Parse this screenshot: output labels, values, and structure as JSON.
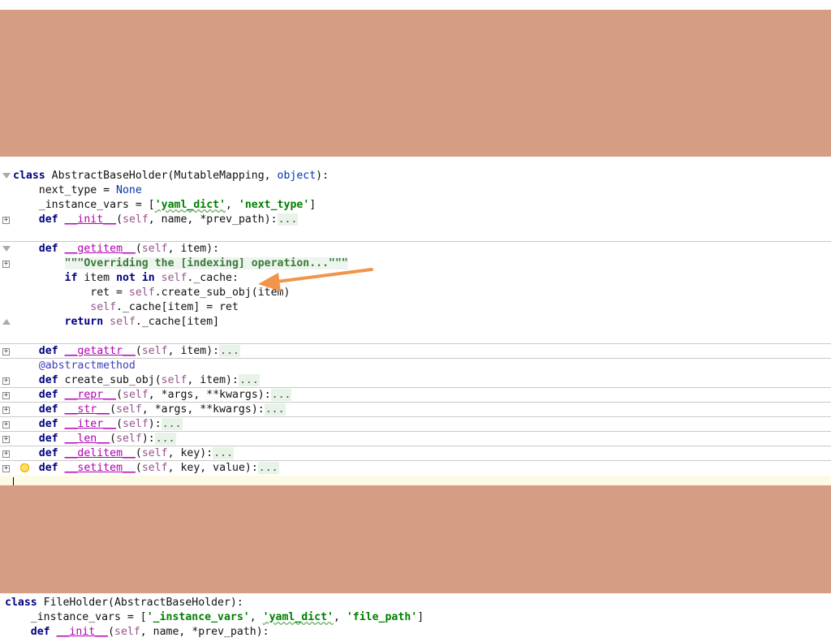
{
  "colors": {
    "band": "#d49d84",
    "arrow": "#f0954a",
    "keyword": "#000080",
    "string": "#008000",
    "self": "#94558d",
    "caret_line": "#fdfbe6"
  },
  "editor": {
    "class_line": {
      "kw": "class",
      "rest": " AbstractBaseHolder(MutableMapping, ",
      "builtin": "object",
      "end": "):"
    },
    "next_type": {
      "name": "next_type = ",
      "value": "None"
    },
    "instance_vars": {
      "prefix": "_instance_vars = [",
      "s1": "'yaml_dict'",
      "mid": ", ",
      "s2": "'next_type'",
      "end": "]"
    },
    "init": {
      "kw": "def",
      "name": "__init__",
      "open": "(",
      "self": "self",
      "args": ", name, *prev_path):",
      "fold": "..."
    },
    "getitem": {
      "kw": "def",
      "name": "__getitem__",
      "open": "(",
      "self": "self",
      "args": ", item):"
    },
    "docstring": "\"\"\"Overriding the [indexing] operation...\"\"\"",
    "if_line": {
      "kw1": "if",
      "mid1": " item ",
      "kw2": "not in",
      "mid2": " ",
      "self": "self",
      "rest": "._cache:"
    },
    "ret_line": {
      "prefix": "ret = ",
      "self": "self",
      "rest": ".create_sub_obj(item)"
    },
    "cache_line": {
      "self": "self",
      "rest": "._cache[item] = ret"
    },
    "return_line": {
      "kw": "return",
      "mid": " ",
      "self": "self",
      "rest": "._cache[item]"
    },
    "getattr": {
      "kw": "def",
      "name": "__getattr__",
      "open": "(",
      "self": "self",
      "args": ", item):",
      "fold": "..."
    },
    "decorator": "@abstractmethod",
    "create_sub_obj": {
      "kw": "def",
      "name": "create_sub_obj",
      "open": "(",
      "self": "self",
      "args": ", item):",
      "fold": "..."
    },
    "repr": {
      "kw": "def",
      "name": "__repr__",
      "open": "(",
      "self": "self",
      "args": ", *args, **kwargs):",
      "fold": "..."
    },
    "str": {
      "kw": "def",
      "name": "__str__",
      "open": "(",
      "self": "self",
      "args": ", *args, **kwargs):",
      "fold": "..."
    },
    "iter": {
      "kw": "def",
      "name": "__iter__",
      "open": "(",
      "self": "self",
      "args": "):",
      "fold": "..."
    },
    "len": {
      "kw": "def",
      "name": "__len__",
      "open": "(",
      "self": "self",
      "args": "):",
      "fold": "..."
    },
    "delitem": {
      "kw": "def",
      "name": "__delitem__",
      "open": "(",
      "self": "self",
      "args": ", key):",
      "fold": "..."
    },
    "setitem": {
      "kw": "def",
      "name": "__setitem__",
      "open": "(",
      "self": "self",
      "args": ", key, value):",
      "fold": "..."
    }
  },
  "editor2": {
    "class_line": {
      "kw": "class",
      "rest": " FileHolder(AbstractBaseHolder):"
    },
    "instance_vars": {
      "prefix": "_instance_vars = [",
      "s1": "'_instance_vars'",
      "mid1": ", ",
      "s2": "'yaml_dict'",
      "mid2": ", ",
      "s3": "'file_path'",
      "end": "]"
    },
    "init": {
      "kw": "def",
      "name": "__init__",
      "open": "(",
      "self": "self",
      "args": ", name, *prev_path):"
    }
  }
}
